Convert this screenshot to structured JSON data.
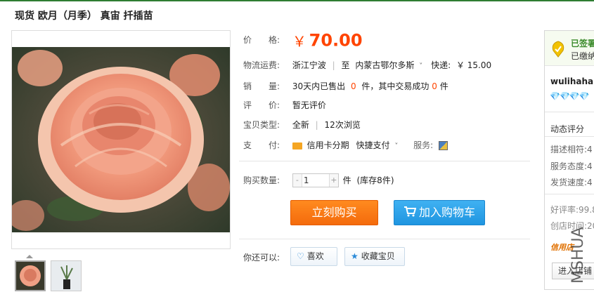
{
  "title": "现货 欧月（月季） 真宙 扦插苗",
  "price": {
    "label": "价　　格:",
    "symbol": "￥",
    "value": "70.00"
  },
  "shipping": {
    "label": "物流运费:",
    "from": "浙江宁波",
    "sep": "|",
    "to_prefix": "至",
    "to": "内蒙古鄂尔多斯",
    "caret": "˅",
    "express_label": "快递:",
    "express_fee": "￥ 15.00"
  },
  "sales": {
    "label": "销　　量:",
    "prefix": "30天内已售出",
    "sold": "0",
    "mid": "件，其中交易成功",
    "success": "0",
    "suffix": "件"
  },
  "review": {
    "label": "评　　价:",
    "value": "暂无评价"
  },
  "item_type": {
    "label": "宝贝类型:",
    "value": "全新",
    "sep": "|",
    "views": "12次浏览"
  },
  "payment": {
    "label": "支　　付:",
    "installment": "信用卡分期",
    "quickpay": "快捷支付",
    "quickpay_caret": "˅",
    "service_label": "服务:"
  },
  "quantity": {
    "label": "购买数量:",
    "minus": "-",
    "value": "1",
    "plus": "+",
    "unit": "件",
    "stock": "(库存8件)"
  },
  "buttons": {
    "buy_now": "立刻购买",
    "add_cart": "加入购物车"
  },
  "also": {
    "label": "你还可以:",
    "like": "喜欢",
    "favorite": "收藏宝贝"
  },
  "seller": {
    "signed": "已签署",
    "deposit": "已缴纳",
    "name": "wulihaha",
    "dynamic_rating": "动态评分",
    "desc_match": "描述相符:4",
    "service_attitude": "服务态度:4",
    "ship_speed": "发货速度:4",
    "good_rate": "好评率:99.8",
    "created": "创店时间:20",
    "credit_badge": "信用店",
    "enter_store": "进入店铺"
  },
  "watermark": "MSHUA",
  "colors": {
    "accent_orange": "#f40",
    "buy_button": "#f46b0c",
    "cart_button": "#1f95e0",
    "top_line": "#2e7d32"
  }
}
